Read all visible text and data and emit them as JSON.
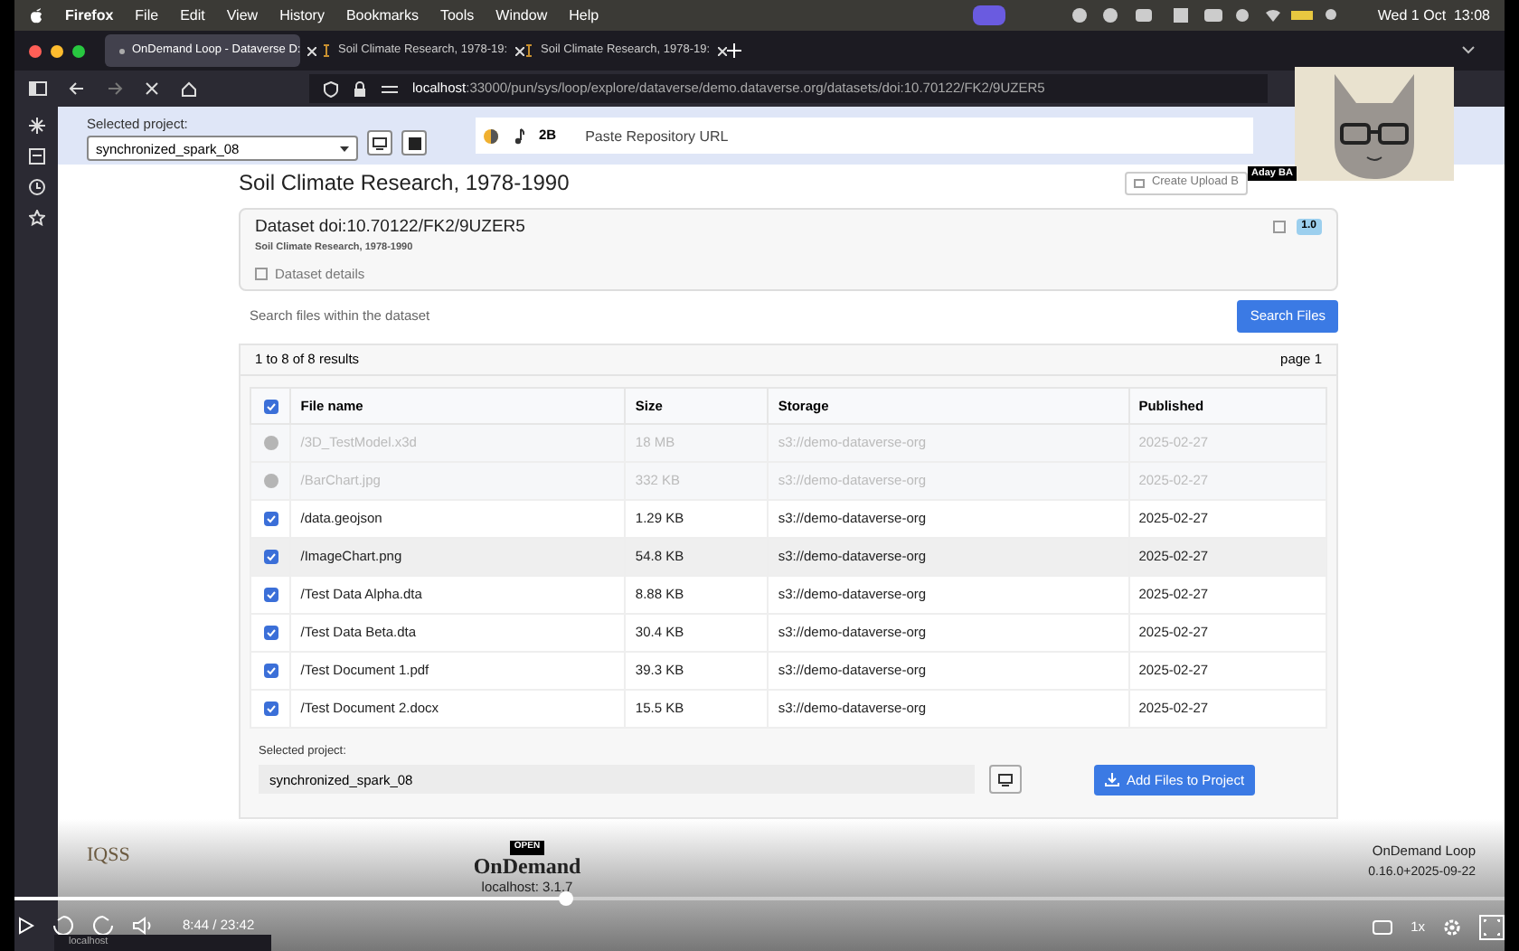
{
  "menubar": {
    "app": "Firefox",
    "menus": [
      "File",
      "Edit",
      "View",
      "History",
      "Bookmarks",
      "Tools",
      "Window",
      "Help"
    ],
    "clock": "Wed 1 Oct  13:08"
  },
  "browser": {
    "tabs": [
      {
        "title": "OnDemand Loop - Dataverse D:",
        "selected": true
      },
      {
        "title": "Soil Climate Research, 1978-19:",
        "selected": false
      },
      {
        "title": "Soil Climate Research, 1978-19:",
        "selected": false
      }
    ],
    "url_host": "localhost",
    "url_path": ":33000/pun/sys/loop/explore/dataverse/demo.dataverse.org/datasets/doi:10.70122/FK2/9UZER5"
  },
  "toolbar": {
    "project_label": "Selected project:",
    "project": "synchronized_spark_08",
    "badge": "2B",
    "repo_placeholder": "Paste Repository URL"
  },
  "page": {
    "title": "Soil Climate Research, 1978-1990",
    "create_button": "Create Upload B",
    "dataset": {
      "title": "Dataset doi:10.70122/FK2/9UZER5",
      "subtitle": "Soil Climate Research, 1978-1990",
      "details": "Dataset details",
      "version": "1.0"
    },
    "search": {
      "placeholder": "Search files within the dataset",
      "button": "Search Files"
    },
    "results": "1 to 8 of 8 results",
    "page_label": "page 1",
    "table": {
      "all_checked": true,
      "columns": [
        "File name",
        "Size",
        "Storage",
        "Published"
      ],
      "rows": [
        {
          "name": "/3D_TestModel.x3d",
          "size": "18 MB",
          "storage": "s3://demo-dataverse-org",
          "published": "2025-02-27",
          "disabled": true,
          "highlighted": false
        },
        {
          "name": "/BarChart.jpg",
          "size": "332 KB",
          "storage": "s3://demo-dataverse-org",
          "published": "2025-02-27",
          "disabled": true,
          "highlighted": false
        },
        {
          "name": "/data.geojson",
          "size": "1.29 KB",
          "storage": "s3://demo-dataverse-org",
          "published": "2025-02-27",
          "disabled": false,
          "highlighted": false
        },
        {
          "name": "/ImageChart.png",
          "size": "54.8 KB",
          "storage": "s3://demo-dataverse-org",
          "published": "2025-02-27",
          "disabled": false,
          "highlighted": true
        },
        {
          "name": "/Test Data Alpha.dta",
          "size": "8.88 KB",
          "storage": "s3://demo-dataverse-org",
          "published": "2025-02-27",
          "disabled": false,
          "highlighted": false
        },
        {
          "name": "/Test Data Beta.dta",
          "size": "30.4 KB",
          "storage": "s3://demo-dataverse-org",
          "published": "2025-02-27",
          "disabled": false,
          "highlighted": false
        },
        {
          "name": "/Test Document 1.pdf",
          "size": "39.3 KB",
          "storage": "s3://demo-dataverse-org",
          "published": "2025-02-27",
          "disabled": false,
          "highlighted": false
        },
        {
          "name": "/Test Document 2.docx",
          "size": "15.5 KB",
          "storage": "s3://demo-dataverse-org",
          "published": "2025-02-27",
          "disabled": false,
          "highlighted": false
        }
      ]
    },
    "bottom": {
      "project_label": "Selected project:",
      "project": "synchronized_spark_08",
      "add_button": "Add Files to Project"
    }
  },
  "webcam": {
    "label": "Aday BA"
  },
  "site_footer": {
    "logo": "IQSS",
    "open": "OPEN",
    "brand": "OnDemand",
    "version": "localhost: 3.1.7",
    "app": "OnDemand Loop",
    "app_version": "0.16.0+2025-09-22"
  },
  "player": {
    "level": 0.37,
    "time": "8:44 / 23:42",
    "speed": "1x",
    "tooltip": "localhost"
  }
}
